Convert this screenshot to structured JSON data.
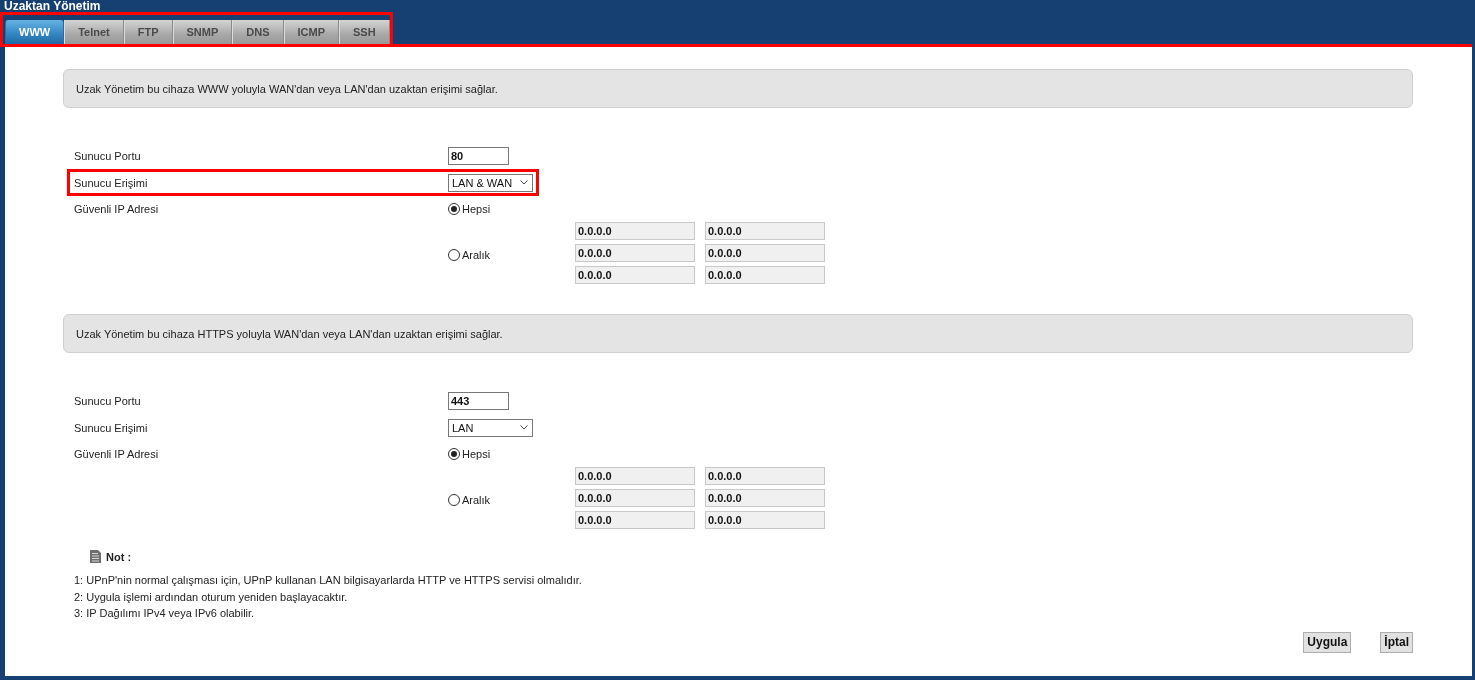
{
  "window": {
    "title": "Uzaktan Yönetim"
  },
  "tab_bar": {
    "highlighted": true,
    "tabs": [
      {
        "label": "WWW",
        "selected": true
      },
      {
        "label": "Telnet",
        "selected": false
      },
      {
        "label": "FTP",
        "selected": false
      },
      {
        "label": "SNMP",
        "selected": false
      },
      {
        "label": "DNS",
        "selected": false
      },
      {
        "label": "ICMP",
        "selected": false
      },
      {
        "label": "SSH",
        "selected": false
      }
    ]
  },
  "content": {
    "highlighted": true,
    "sections": [
      {
        "description": "Uzak Yönetim bu cihaza WWW yoluyla WAN'dan veya LAN'dan uzaktan erişimi sağlar.",
        "fields": [
          {
            "kind": "text",
            "label": "Sunucu Portu",
            "value": "80",
            "highlighted": false
          },
          {
            "kind": "select",
            "label": "Sunucu Erişimi",
            "value": "LAN & WAN",
            "highlighted": true
          },
          {
            "kind": "ip_range",
            "label": "Güvenli IP Adresi",
            "highlighted": false,
            "options": [
              {
                "label": "Hepsi",
                "selected": true
              },
              {
                "label": "Aralık",
                "selected": false
              }
            ],
            "ranges": [
              {
                "start": "0.0.0.0",
                "end": "0.0.0.0"
              },
              {
                "start": "0.0.0.0",
                "end": "0.0.0.0"
              },
              {
                "start": "0.0.0.0",
                "end": "0.0.0.0"
              }
            ]
          }
        ]
      },
      {
        "description": "Uzak Yönetim bu cihaza HTTPS yoluyla WAN'dan veya LAN'dan uzaktan erişimi sağlar.",
        "fields": [
          {
            "kind": "text",
            "label": "Sunucu Portu",
            "value": "443",
            "highlighted": false
          },
          {
            "kind": "select",
            "label": "Sunucu Erişimi",
            "value": "LAN",
            "highlighted": false
          },
          {
            "kind": "ip_range",
            "label": "Güvenli IP Adresi",
            "highlighted": false,
            "options": [
              {
                "label": "Hepsi",
                "selected": true
              },
              {
                "label": "Aralık",
                "selected": false
              }
            ],
            "ranges": [
              {
                "start": "0.0.0.0",
                "end": "0.0.0.0"
              },
              {
                "start": "0.0.0.0",
                "end": "0.0.0.0"
              },
              {
                "start": "0.0.0.0",
                "end": "0.0.0.0"
              }
            ]
          }
        ]
      }
    ]
  },
  "note": {
    "title": "Not :",
    "lines": [
      "1: UPnP'nin normal çalışması için, UPnP kullanan LAN bilgisayarlarda HTTP ve HTTPS servisi olmalıdır.",
      "2: Uygula işlemi ardından oturum yeniden başlayacaktır.",
      "3: IP Dağılımı IPv4 veya IPv6 olabilir."
    ]
  },
  "buttons": [
    "Uygula",
    "İptal"
  ]
}
